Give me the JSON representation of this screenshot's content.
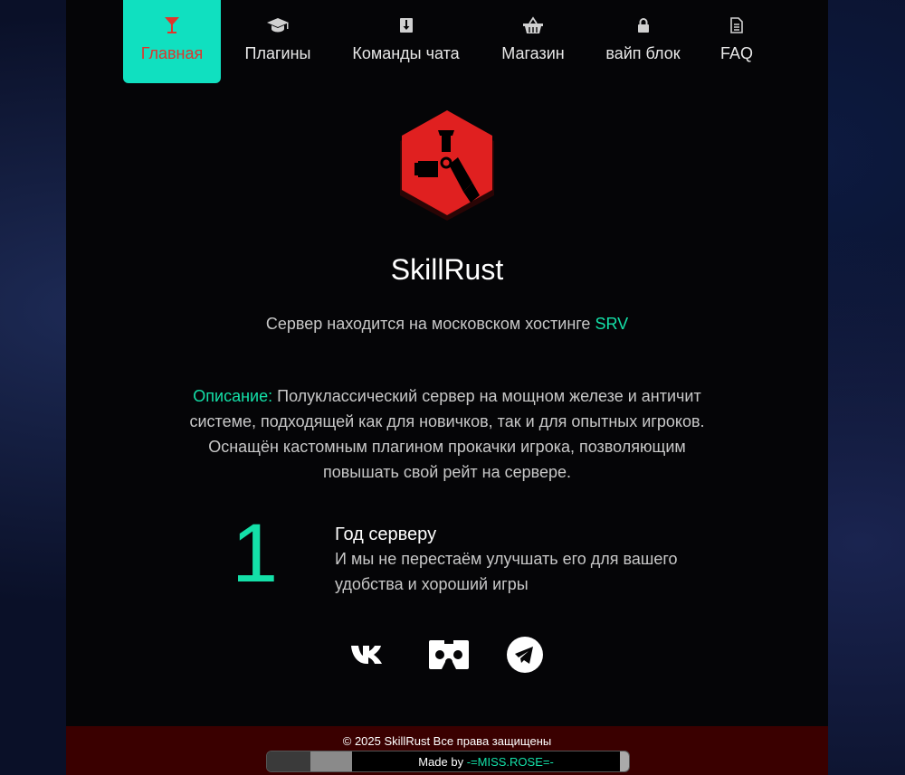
{
  "colors": {
    "accent": "#14e0a8",
    "active_bg": "#10e0c0",
    "active_text": "#e0342c",
    "footer_bg": "#3a0000",
    "logo_red": "#e02020"
  },
  "nav": {
    "items": [
      {
        "label": "Главная",
        "icon": "cocktail-icon",
        "active": true
      },
      {
        "label": "Плагины",
        "icon": "graduation-cap-icon",
        "active": false
      },
      {
        "label": "Команды чата",
        "icon": "download-icon",
        "active": false
      },
      {
        "label": "Магазин",
        "icon": "basket-icon",
        "active": false
      },
      {
        "label": "вайп блок",
        "icon": "lock-icon",
        "active": false
      },
      {
        "label": "FAQ",
        "icon": "document-icon",
        "active": false
      }
    ]
  },
  "server": {
    "name": "SkillRust",
    "hosting_text": "Сервер находится на московском хостинге ",
    "hosting_name": "SRV"
  },
  "description": {
    "label": "Описание:",
    "text": " Полуклассический сервер на мощном железе и античит системе, подходящей как для новичков, так и для опытных игроков. Оснащён кастомным плагином прокачки игрока, позволяющим повышать свой рейт на сервере."
  },
  "age": {
    "number": "1",
    "title": "Год серверу",
    "text": "И мы не перестаём улучшать его для вашего удобства и хороший игры"
  },
  "social": [
    "vk-icon",
    "vr-cardboard-icon",
    "telegram-icon"
  ],
  "footer": {
    "copyright": "© 2025 SkillRust Все права защищены",
    "made_by_label": "Made by ",
    "made_by_name": "-=MISS.ROSE=-"
  }
}
